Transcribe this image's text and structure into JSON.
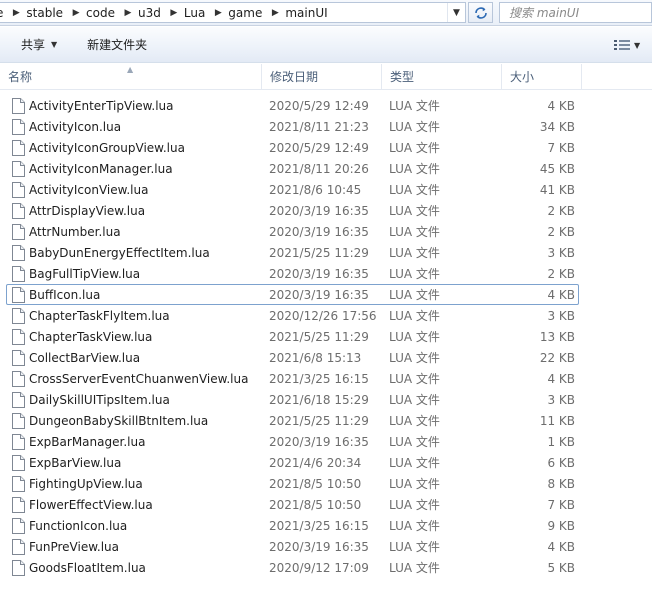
{
  "address": {
    "crumbs": [
      "e",
      "stable",
      "code",
      "u3d",
      "Lua",
      "game",
      "mainUI"
    ]
  },
  "search": {
    "placeholder": "搜索 mainUI"
  },
  "toolbar": {
    "share_label": "共享",
    "new_folder_label": "新建文件夹"
  },
  "columns": {
    "name": "名称",
    "date": "修改日期",
    "type": "类型",
    "size": "大小"
  },
  "focused_row": 9,
  "files": [
    {
      "name": "ActivityEnterTipView.lua",
      "date": "2020/5/29 12:49",
      "type": "LUA 文件",
      "size": "4 KB"
    },
    {
      "name": "ActivityIcon.lua",
      "date": "2021/8/11 21:23",
      "type": "LUA 文件",
      "size": "34 KB"
    },
    {
      "name": "ActivityIconGroupView.lua",
      "date": "2020/5/29 12:49",
      "type": "LUA 文件",
      "size": "7 KB"
    },
    {
      "name": "ActivityIconManager.lua",
      "date": "2021/8/11 20:26",
      "type": "LUA 文件",
      "size": "45 KB"
    },
    {
      "name": "ActivityIconView.lua",
      "date": "2021/8/6 10:45",
      "type": "LUA 文件",
      "size": "41 KB"
    },
    {
      "name": "AttrDisplayView.lua",
      "date": "2020/3/19 16:35",
      "type": "LUA 文件",
      "size": "2 KB"
    },
    {
      "name": "AttrNumber.lua",
      "date": "2020/3/19 16:35",
      "type": "LUA 文件",
      "size": "2 KB"
    },
    {
      "name": "BabyDunEnergyEffectItem.lua",
      "date": "2021/5/25 11:29",
      "type": "LUA 文件",
      "size": "3 KB"
    },
    {
      "name": "BagFullTipView.lua",
      "date": "2020/3/19 16:35",
      "type": "LUA 文件",
      "size": "2 KB"
    },
    {
      "name": "BuffIcon.lua",
      "date": "2020/3/19 16:35",
      "type": "LUA 文件",
      "size": "4 KB"
    },
    {
      "name": "ChapterTaskFlyItem.lua",
      "date": "2020/12/26 17:56",
      "type": "LUA 文件",
      "size": "3 KB"
    },
    {
      "name": "ChapterTaskView.lua",
      "date": "2021/5/25 11:29",
      "type": "LUA 文件",
      "size": "13 KB"
    },
    {
      "name": "CollectBarView.lua",
      "date": "2021/6/8 15:13",
      "type": "LUA 文件",
      "size": "22 KB"
    },
    {
      "name": "CrossServerEventChuanwenView.lua",
      "date": "2021/3/25 16:15",
      "type": "LUA 文件",
      "size": "4 KB"
    },
    {
      "name": "DailySkillUITipsItem.lua",
      "date": "2021/6/18 15:29",
      "type": "LUA 文件",
      "size": "3 KB"
    },
    {
      "name": "DungeonBabySkillBtnItem.lua",
      "date": "2021/5/25 11:29",
      "type": "LUA 文件",
      "size": "11 KB"
    },
    {
      "name": "ExpBarManager.lua",
      "date": "2020/3/19 16:35",
      "type": "LUA 文件",
      "size": "1 KB"
    },
    {
      "name": "ExpBarView.lua",
      "date": "2021/4/6 20:34",
      "type": "LUA 文件",
      "size": "6 KB"
    },
    {
      "name": "FightingUpView.lua",
      "date": "2021/8/5 10:50",
      "type": "LUA 文件",
      "size": "8 KB"
    },
    {
      "name": "FlowerEffectView.lua",
      "date": "2021/8/5 10:50",
      "type": "LUA 文件",
      "size": "7 KB"
    },
    {
      "name": "FunctionIcon.lua",
      "date": "2021/3/25 16:15",
      "type": "LUA 文件",
      "size": "9 KB"
    },
    {
      "name": "FunPreView.lua",
      "date": "2020/3/19 16:35",
      "type": "LUA 文件",
      "size": "4 KB"
    },
    {
      "name": "GoodsFloatItem.lua",
      "date": "2020/9/12 17:09",
      "type": "LUA 文件",
      "size": "5 KB"
    }
  ]
}
